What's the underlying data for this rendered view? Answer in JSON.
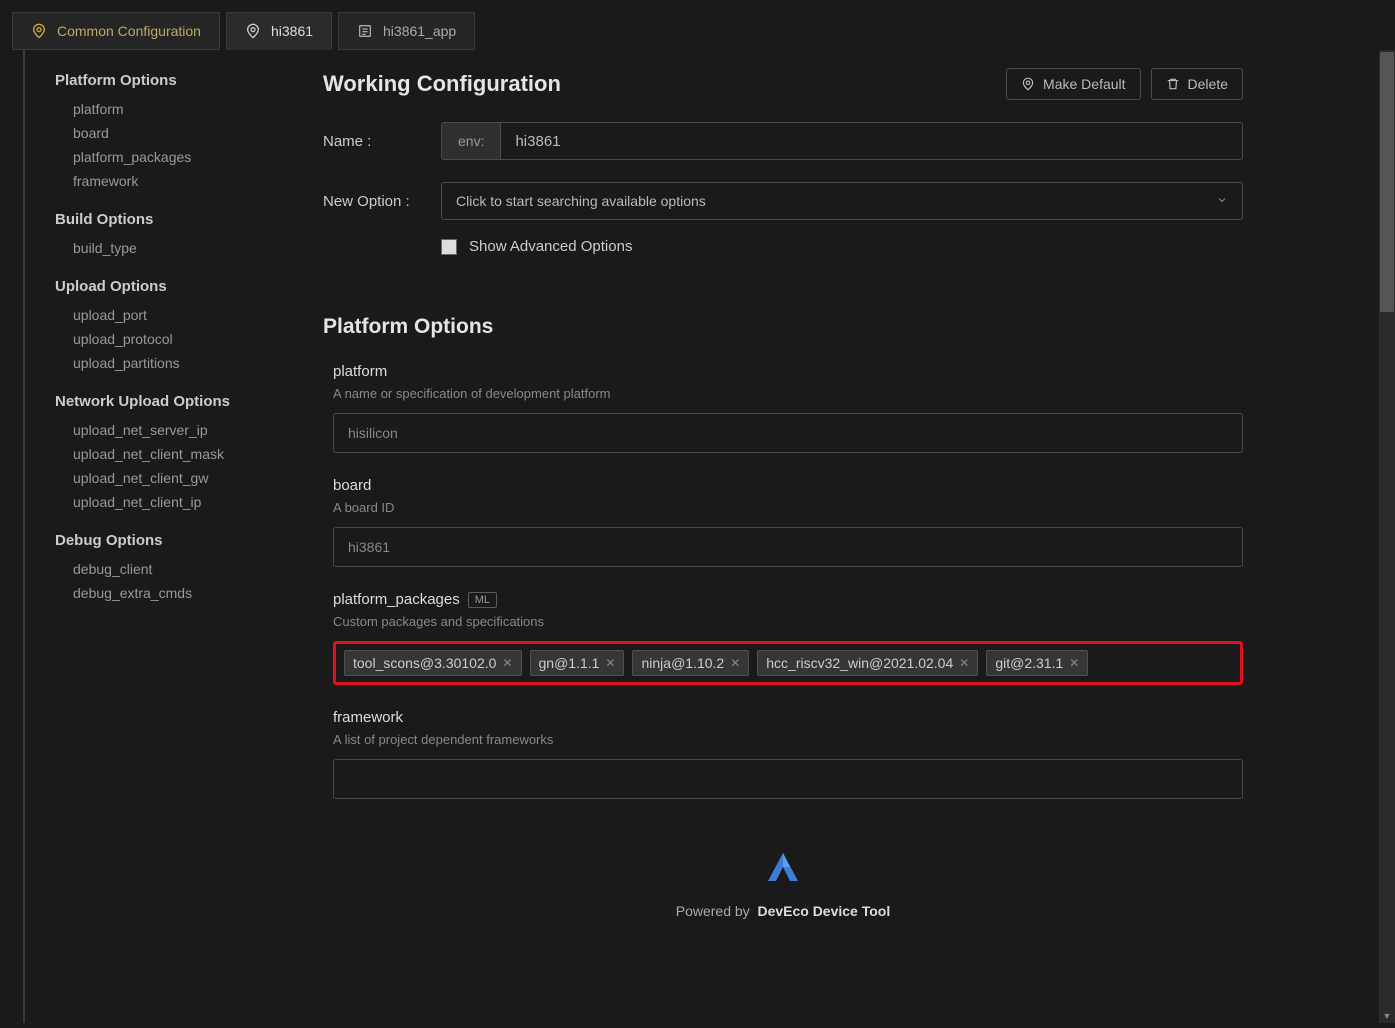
{
  "tabs": {
    "common": "Common Configuration",
    "hi3861": "hi3861",
    "hi3861_app": "hi3861_app"
  },
  "sidebar": {
    "platform_options": "Platform Options",
    "platform": "platform",
    "board": "board",
    "platform_packages": "platform_packages",
    "framework": "framework",
    "build_options": "Build Options",
    "build_type": "build_type",
    "upload_options": "Upload Options",
    "upload_port": "upload_port",
    "upload_protocol": "upload_protocol",
    "upload_partitions": "upload_partitions",
    "network_upload_options": "Network Upload Options",
    "upload_net_server_ip": "upload_net_server_ip",
    "upload_net_client_mask": "upload_net_client_mask",
    "upload_net_client_gw": "upload_net_client_gw",
    "upload_net_client_ip": "upload_net_client_ip",
    "debug_options": "Debug Options",
    "debug_client": "debug_client",
    "debug_extra_cmds": "debug_extra_cmds"
  },
  "main": {
    "working_configuration": "Working Configuration",
    "make_default": "Make Default",
    "delete": "Delete",
    "name_label": "Name :",
    "env_prefix": "env:",
    "name_value": "hi3861",
    "new_option_label": "New Option :",
    "new_option_placeholder": "Click to start searching available options",
    "show_advanced": "Show Advanced Options",
    "platform_options_title": "Platform Options",
    "platform": {
      "name": "platform",
      "desc": "A name or specification of development platform",
      "placeholder": "hisilicon"
    },
    "board": {
      "name": "board",
      "desc": "A board ID",
      "placeholder": "hi3861"
    },
    "platform_packages": {
      "name": "platform_packages",
      "badge": "ML",
      "desc": "Custom packages and specifications",
      "tags": [
        "tool_scons@3.30102.0",
        "gn@1.1.1",
        "ninja@1.10.2",
        "hcc_riscv32_win@2021.02.04",
        "git@2.31.1"
      ]
    },
    "framework": {
      "name": "framework",
      "desc": "A list of project dependent frameworks"
    }
  },
  "footer": {
    "powered_by": "Powered by",
    "tool": "DevEco Device Tool"
  }
}
